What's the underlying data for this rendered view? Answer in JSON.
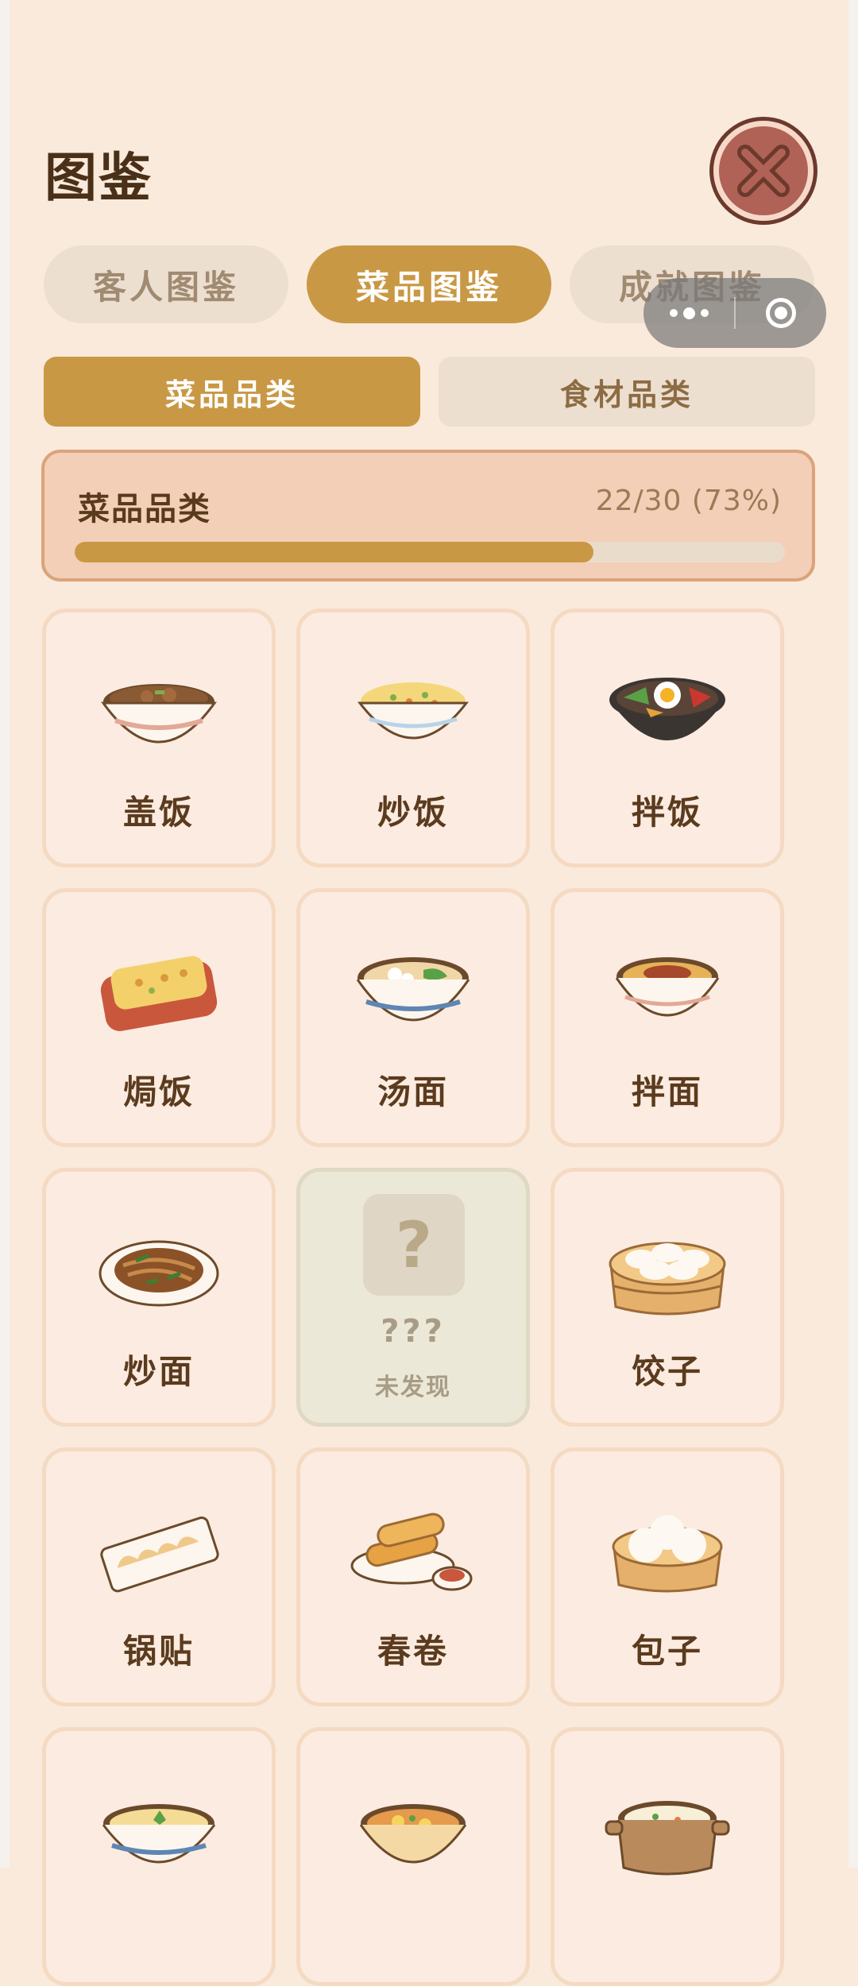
{
  "page": {
    "title": "图鉴"
  },
  "tabs": [
    {
      "label": "客人图鉴",
      "active": false
    },
    {
      "label": "菜品图鉴",
      "active": true
    },
    {
      "label": "成就图鉴",
      "active": false
    }
  ],
  "subtabs": [
    {
      "label": "菜品品类",
      "active": true
    },
    {
      "label": "食材品类",
      "active": false
    }
  ],
  "progress": {
    "title": "菜品品类",
    "count_text": "22/30 (73%)",
    "fraction": 0.73
  },
  "dishes": [
    {
      "name": "盖饭",
      "icon": "rice-bowl-topped-icon",
      "discovered": true
    },
    {
      "name": "炒饭",
      "icon": "fried-rice-icon",
      "discovered": true
    },
    {
      "name": "拌饭",
      "icon": "bibimbap-icon",
      "discovered": true
    },
    {
      "name": "焗饭",
      "icon": "baked-rice-icon",
      "discovered": true
    },
    {
      "name": "汤面",
      "icon": "soup-noodles-icon",
      "discovered": true
    },
    {
      "name": "拌面",
      "icon": "mixed-noodles-icon",
      "discovered": true
    },
    {
      "name": "炒面",
      "icon": "fried-noodles-icon",
      "discovered": true
    },
    {
      "name": "???",
      "icon": "question-mark-icon",
      "discovered": false,
      "status": "未发现"
    },
    {
      "name": "饺子",
      "icon": "dumplings-steamer-icon",
      "discovered": true
    },
    {
      "name": "锅贴",
      "icon": "potstickers-icon",
      "discovered": true
    },
    {
      "name": "春卷",
      "icon": "spring-rolls-icon",
      "discovered": true
    },
    {
      "name": "包子",
      "icon": "steamed-buns-icon",
      "discovered": true
    },
    {
      "name": "",
      "icon": "egg-custard-icon",
      "discovered": true
    },
    {
      "name": "",
      "icon": "tomato-egg-soup-icon",
      "discovered": true
    },
    {
      "name": "",
      "icon": "congee-pot-icon",
      "discovered": true
    }
  ],
  "colors": {
    "accent": "#c99844",
    "background": "#faeadc",
    "card": "#fcebe0",
    "text": "#5b3b1e"
  }
}
